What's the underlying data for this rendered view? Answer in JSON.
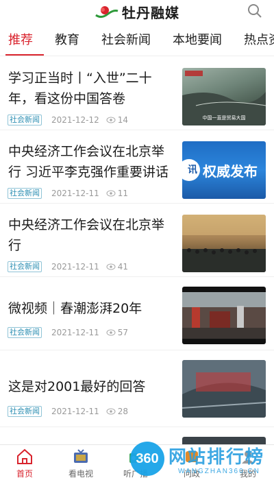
{
  "header": {
    "app_name": "牡丹融媒",
    "logo_icon": "peony-logo",
    "search_icon": "search-icon"
  },
  "tabs": [
    {
      "label": "推荐",
      "active": true
    },
    {
      "label": "教育",
      "active": false
    },
    {
      "label": "社会新闻",
      "active": false
    },
    {
      "label": "本地要闻",
      "active": false
    },
    {
      "label": "热点资",
      "active": false
    }
  ],
  "feed": [
    {
      "title": "学习正当时丨“入世”二十年，看这份中国答卷",
      "tag": "社会新闻",
      "date": "2021-12-12",
      "views": "14",
      "thumb_caption": "中国一直是贸易大国"
    },
    {
      "title": "中央经济工作会议在北京举行 习近平李克强作重要讲话",
      "tag": "社会新闻",
      "date": "2021-12-11",
      "views": "11",
      "thumb_caption": "权威发布"
    },
    {
      "title": "中央经济工作会议在北京举行",
      "tag": "社会新闻",
      "date": "2021-12-11",
      "views": "41",
      "thumb_caption": ""
    },
    {
      "title": "微视频｜春潮澎湃20年",
      "tag": "社会新闻",
      "date": "2021-12-11",
      "views": "57",
      "thumb_caption": ""
    },
    {
      "title": "这是对2001最好的回答",
      "tag": "社会新闻",
      "date": "2021-12-11",
      "views": "28",
      "thumb_caption": ""
    }
  ],
  "bottom_nav": [
    {
      "label": "首页",
      "icon": "home-icon",
      "active": true
    },
    {
      "label": "看电视",
      "icon": "tv-icon",
      "active": false
    },
    {
      "label": "听广播",
      "icon": "radio-icon",
      "active": false
    },
    {
      "label": "问政",
      "icon": "inquiry-icon",
      "active": false
    },
    {
      "label": "我的",
      "icon": "profile-icon",
      "active": false
    }
  ],
  "watermark": {
    "title": "网站排行榜",
    "sub": "WANGZHAN360.CN",
    "badge": "360"
  },
  "colors": {
    "accent": "#d9232d",
    "tag": "#2d8fb3"
  }
}
